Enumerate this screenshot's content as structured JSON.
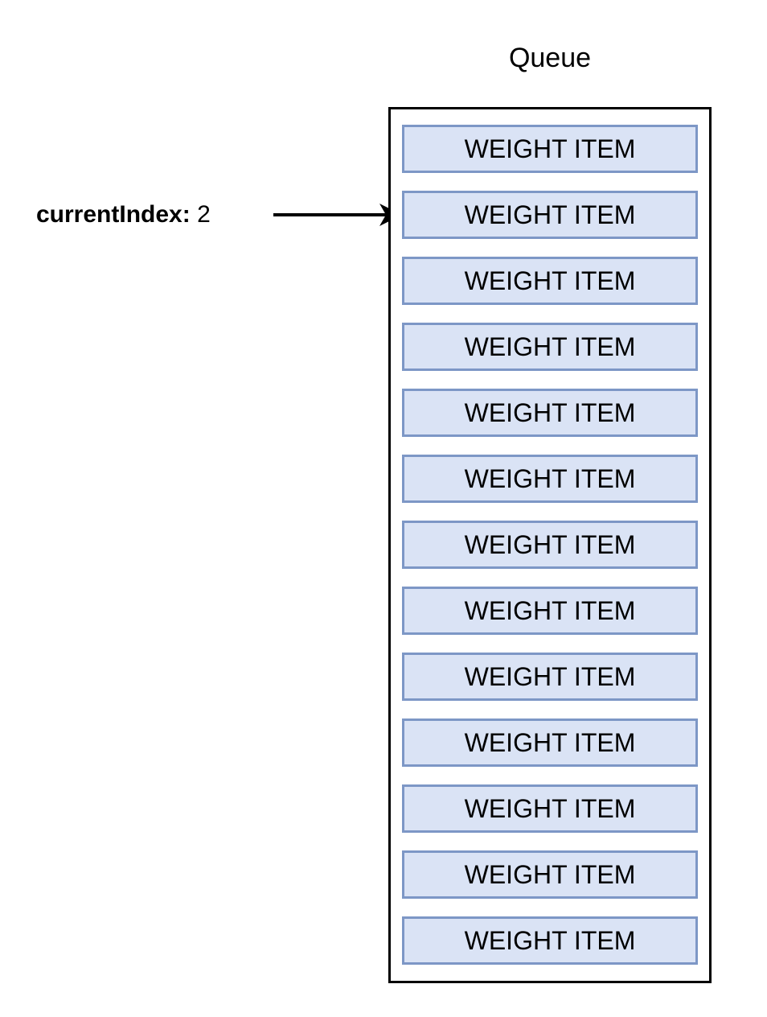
{
  "diagram": {
    "title": "Queue",
    "pointer": {
      "key": "currentIndex",
      "separator": ":",
      "value": "2",
      "target_item_index": 1,
      "arrow_icon": "arrow-right-icon"
    },
    "colors": {
      "item_fill": "#dae3f5",
      "item_border": "#7d97c6",
      "container_border": "#000000",
      "text": "#000000",
      "background": "#ffffff"
    },
    "queue": {
      "item_label": "WEIGHT ITEM",
      "item_count": 13,
      "items": [
        {
          "label": "WEIGHT ITEM"
        },
        {
          "label": "WEIGHT ITEM"
        },
        {
          "label": "WEIGHT ITEM"
        },
        {
          "label": "WEIGHT ITEM"
        },
        {
          "label": "WEIGHT ITEM"
        },
        {
          "label": "WEIGHT ITEM"
        },
        {
          "label": "WEIGHT ITEM"
        },
        {
          "label": "WEIGHT ITEM"
        },
        {
          "label": "WEIGHT ITEM"
        },
        {
          "label": "WEIGHT ITEM"
        },
        {
          "label": "WEIGHT ITEM"
        },
        {
          "label": "WEIGHT ITEM"
        },
        {
          "label": "WEIGHT ITEM"
        }
      ]
    }
  }
}
